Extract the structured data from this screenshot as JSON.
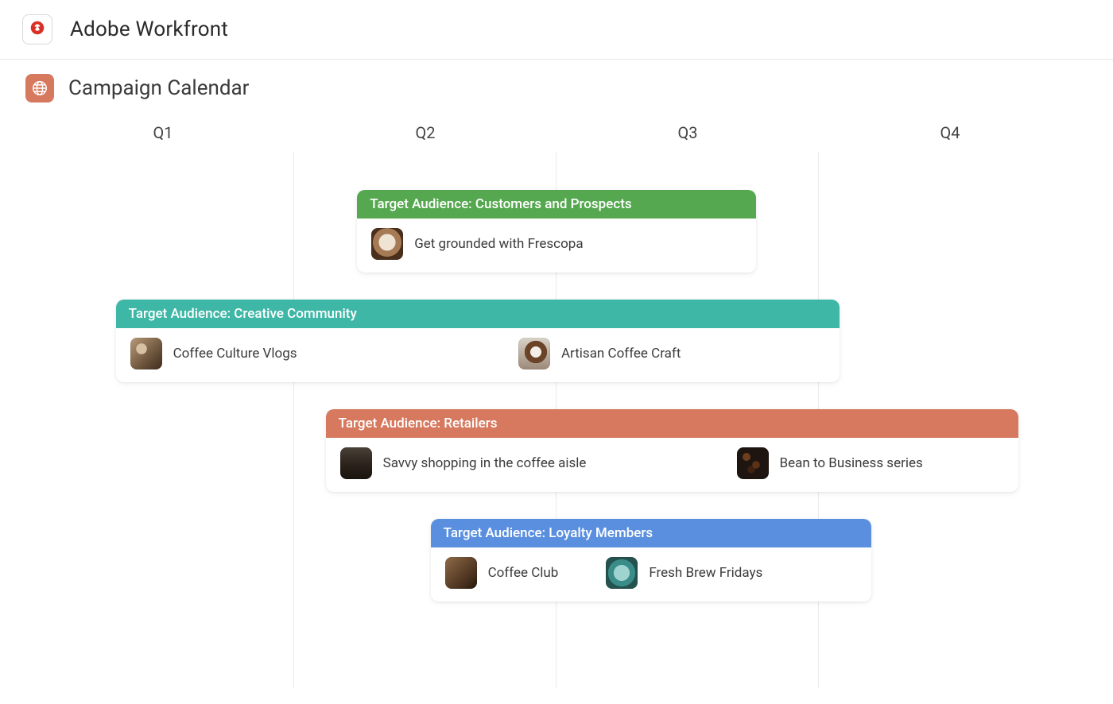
{
  "app": {
    "title": "Adobe Workfront"
  },
  "page": {
    "title": "Campaign Calendar"
  },
  "calendar": {
    "columns": [
      "Q1",
      "Q2",
      "Q3",
      "Q4"
    ],
    "groups": [
      {
        "header": "Target Audience: Customers and Prospects",
        "color": "green",
        "start_pct": 31,
        "width_pct": 38,
        "items": [
          {
            "label": "Get grounded with Frescopa",
            "thumb": "th-latte"
          }
        ]
      },
      {
        "header": "Target Audience: Creative Community",
        "color": "teal",
        "start_pct": 8,
        "width_pct": 69,
        "items": [
          {
            "label": "Coffee Culture Vlogs",
            "thumb": "th-person"
          },
          {
            "label": "Artisan Coffee Craft",
            "thumb": "th-cup"
          }
        ]
      },
      {
        "header": "Target Audience: Retailers",
        "color": "coral",
        "start_pct": 28,
        "width_pct": 66,
        "items": [
          {
            "label": "Savvy shopping in the coffee aisle",
            "thumb": "th-machine"
          },
          {
            "label": "Bean to Business series",
            "thumb": "th-beans"
          }
        ]
      },
      {
        "header": "Target Audience: Loyalty Members",
        "color": "blue",
        "start_pct": 38,
        "width_pct": 42,
        "items": [
          {
            "label": "Coffee Club",
            "thumb": "th-barista"
          },
          {
            "label": "Fresh Brew Fridays",
            "thumb": "th-mug"
          }
        ]
      }
    ]
  }
}
